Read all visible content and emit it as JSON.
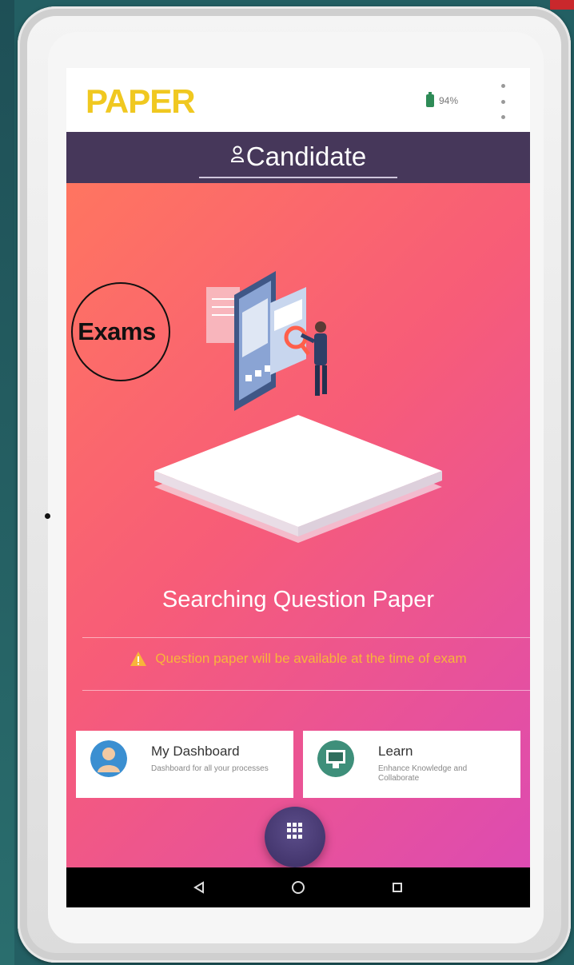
{
  "app": {
    "logo": "PAPER",
    "battery": "94%"
  },
  "header": {
    "title": "Candidate",
    "icon": "person-icon"
  },
  "main": {
    "status_text": "Searching Question Paper",
    "warning_text": "Question paper will be available at the time of exam",
    "warning_icon": "warning-icon"
  },
  "cards": [
    {
      "title": "My Dashboard",
      "description": "Dashboard for all your processes",
      "icon": "dashboard-avatar-icon"
    },
    {
      "title": "Learn",
      "description": "Enhance Knowledge and Collaborate",
      "icon": "learn-presentation-icon"
    }
  ],
  "fab": {
    "icon": "apps-grid-icon"
  },
  "nav": {
    "back": "back-icon",
    "home": "home-icon",
    "recents": "recents-icon"
  },
  "annotation": {
    "label": "Exams"
  },
  "colors": {
    "logo": "#f0c820",
    "header_bar": "#46375a",
    "gradient_start": "#ff7560",
    "gradient_end": "#dd4bb2",
    "warning": "#f8b53a"
  }
}
